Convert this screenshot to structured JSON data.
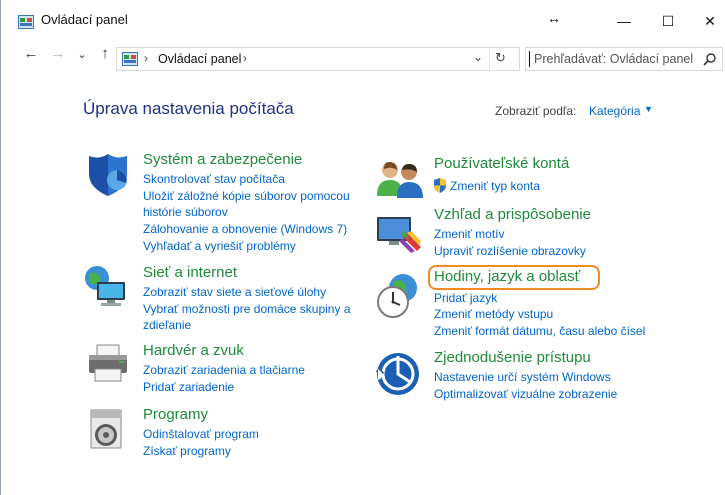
{
  "window": {
    "title": "Ovládací panel",
    "resize_glyph": "↔",
    "minimize_glyph": "—",
    "maximize_glyph": "☐",
    "close_glyph": "✕"
  },
  "nav": {
    "back": "←",
    "forward": "→",
    "recent": "⌄",
    "up": "↑"
  },
  "address": {
    "sep": "›",
    "path": "Ovládací panel",
    "sep_end": "›",
    "dropdown": "⌄",
    "refresh": "↻"
  },
  "search": {
    "placeholder": "Prehľadávať: Ovládací panel"
  },
  "content": {
    "title": "Úprava nastavenia počítača",
    "view_by_label": "Zobraziť podľa:",
    "view_by_value": "Kategória",
    "view_by_caret": "▼"
  },
  "categories_left": [
    {
      "title": "Systém a zabezpečenie",
      "links": [
        "Skontrolovať stav počítača",
        "Uložiť záložné kópie súborov pomocou",
        "histórie súborov",
        "Zálohovanie a obnovenie (Windows 7)",
        "Vyhľadať a vyriešiť problémy"
      ]
    },
    {
      "title": "Sieť a internet",
      "links": [
        "Zobraziť stav siete a sieťové úlohy",
        "Vybrať možnosti pre domáce skupiny a",
        "zdieľanie"
      ]
    },
    {
      "title": "Hardvér a zvuk",
      "links": [
        "Zobraziť zariadenia a tlačiarne",
        "Pridať zariadenie"
      ]
    },
    {
      "title": "Programy",
      "links": [
        "Odinštalovať program",
        "Získať programy"
      ]
    }
  ],
  "categories_right": [
    {
      "title": "Používateľské kontá",
      "links": [
        "Zmeniť typ konta"
      ]
    },
    {
      "title": "Vzhľad a prispôsobenie",
      "links": [
        "Zmeniť motív",
        "Upraviť rozlíšenie obrazovky"
      ]
    },
    {
      "title": "Hodiny, jazyk a oblasť",
      "links": [
        "Pridať jazyk",
        "Zmeniť metódy vstupu",
        "Zmeniť formát dátumu, času alebo čísel"
      ]
    },
    {
      "title": "Zjednodušenie prístupu",
      "links": [
        "Nastavenie určí systém Windows",
        "Optimalizovať vizuálne zobrazenie"
      ]
    }
  ],
  "colors": {
    "title_blue": "#1e3287",
    "link_blue": "#0066cc",
    "category_green": "#1e8a3a",
    "highlight_orange": "#f08a24"
  }
}
